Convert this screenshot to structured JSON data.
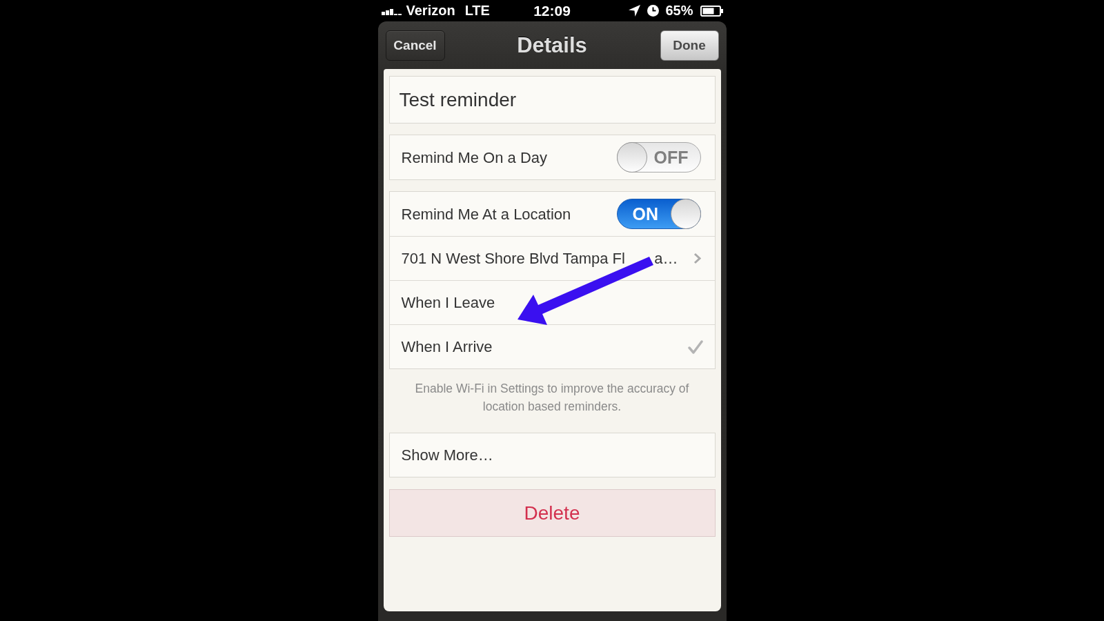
{
  "status_bar": {
    "carrier": "Verizon",
    "network": "LTE",
    "time": "12:09",
    "battery": "65%"
  },
  "nav_bar": {
    "left_button": "Cancel",
    "title": "Details",
    "right_button": "Done"
  },
  "title_field": {
    "value": "Test reminder"
  },
  "groups": [
    {
      "rows": [
        {
          "kind": "toggle",
          "label": "Remind Me On a Day",
          "on": false,
          "switch_text": "OFF"
        }
      ]
    },
    {
      "rows": [
        {
          "kind": "toggle",
          "label": "Remind Me At a Location",
          "on": true,
          "switch_text": "ON"
        },
        {
          "kind": "link",
          "label_parts": [
            "701 N West Shore Blvd Tampa Fl",
            "a…"
          ]
        },
        {
          "kind": "choice",
          "label": "When I Leave",
          "selected": false
        },
        {
          "kind": "choice",
          "label": "When I Arrive",
          "selected": true
        }
      ]
    }
  ],
  "footer_note": "Enable Wi-Fi in Settings to improve the accuracy of location based reminders.",
  "show_more": "Show More…",
  "delete_button": "Delete"
}
